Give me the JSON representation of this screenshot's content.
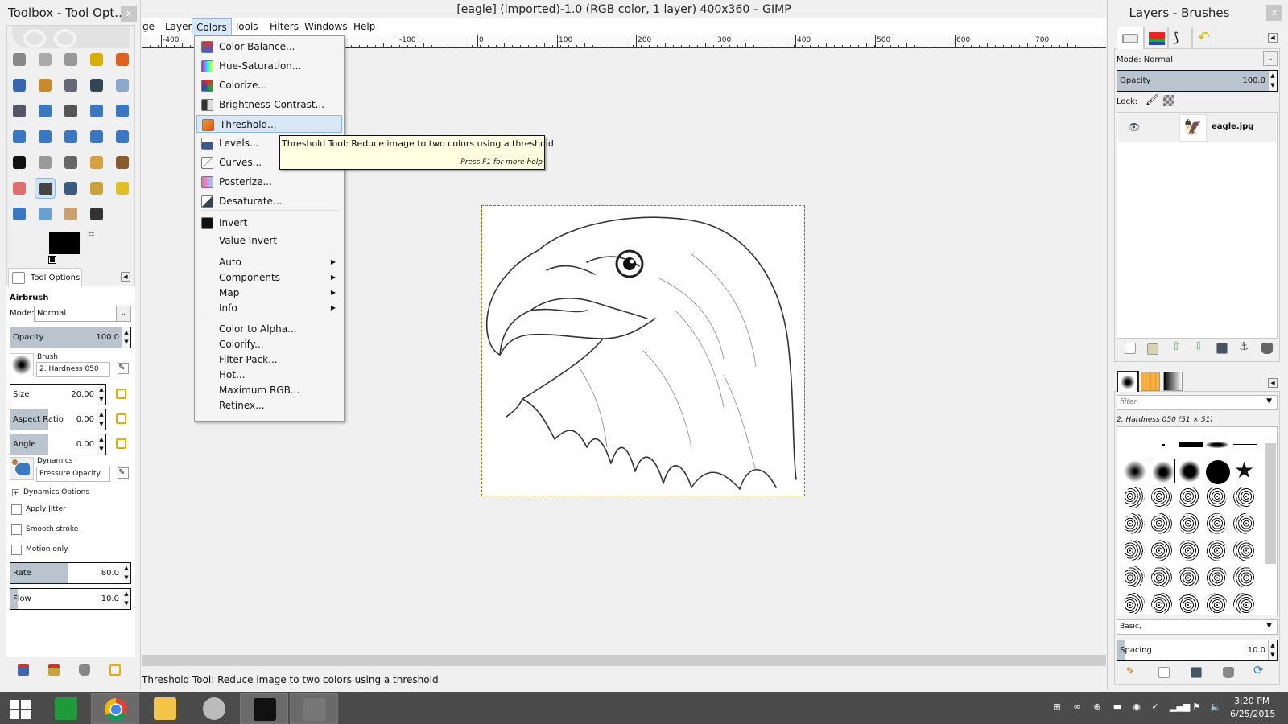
{
  "toolbox": {
    "title": "Toolbox - Tool Opt...",
    "close": "x",
    "tools": [
      "rect-select",
      "ellipse-select",
      "free-select",
      "fuzzy-select",
      "select-by-color",
      "scissors-select",
      "foreground-select",
      "paths",
      "color-picker",
      "zoom",
      "measure",
      "move",
      "align",
      "crop",
      "rotate",
      "scale",
      "shear",
      "perspective",
      "flip",
      "cage-transform",
      "text",
      "bucket-fill",
      "blend",
      "pencil",
      "paintbrush",
      "eraser",
      "airbrush",
      "ink",
      "clone",
      "heal",
      "perspective-clone",
      "blur-sharpen",
      "smudge",
      "dodge-burn"
    ],
    "selected_tool": "airbrush",
    "fg_color": "#000000",
    "bg_color": "#ffffff"
  },
  "tool_options": {
    "tab": "Tool Options",
    "tool_name": "Airbrush",
    "mode_label": "Mode:",
    "mode_value": "Normal",
    "opacity": {
      "label": "Opacity",
      "value": "100.0",
      "fraction": 1.0
    },
    "brush_label": "Brush",
    "brush_value": "2. Hardness 050",
    "size": {
      "label": "Size",
      "value": "20.00"
    },
    "aspect": {
      "label": "Aspect Ratio",
      "value": "0.00"
    },
    "angle": {
      "label": "Angle",
      "value": "0.00"
    },
    "dynamics_label": "Dynamics",
    "dynamics_value": "Pressure Opacity",
    "dynamics_options": "Dynamics Options",
    "apply_jitter": "Apply Jitter",
    "smooth_stroke": "Smooth stroke",
    "motion_only": "Motion only",
    "rate": {
      "label": "Rate",
      "value": "80.0",
      "fraction": 0.8
    },
    "flow": {
      "label": "Flow",
      "value": "10.0",
      "fraction": 0.1
    }
  },
  "main": {
    "title": "[eagle] (imported)-1.0 (RGB color, 1 layer) 400x360 – GIMP",
    "menubar": [
      "ge",
      "Layer",
      "Colors",
      "Tools",
      "Filters",
      "Windows",
      "Help"
    ],
    "active_menu": "Colors",
    "ruler_labels": [
      "-400",
      "-100",
      "0",
      "100",
      "200",
      "300",
      "400",
      "500",
      "600",
      "700"
    ],
    "status": "Threshold Tool: Reduce image to two colors using a threshold"
  },
  "colors_menu": {
    "items": [
      {
        "label": "Color Balance...",
        "icon": "color-balance-icon"
      },
      {
        "label": "Hue-Saturation...",
        "icon": "hue-saturation-icon"
      },
      {
        "label": "Colorize...",
        "icon": "colorize-icon"
      },
      {
        "label": "Brightness-Contrast...",
        "icon": "brightness-contrast-icon"
      },
      {
        "label": "Threshold...",
        "icon": "threshold-icon"
      },
      {
        "label": "Levels...",
        "icon": "levels-icon"
      },
      {
        "label": "Curves...",
        "icon": "curves-icon"
      },
      {
        "label": "Posterize...",
        "icon": "posterize-icon"
      },
      {
        "label": "Desaturate...",
        "icon": "desaturate-icon"
      },
      {
        "label": "Invert",
        "icon": "invert-icon"
      },
      {
        "label": "Value Invert"
      },
      {
        "label": "Auto",
        "submenu": true
      },
      {
        "label": "Components",
        "submenu": true
      },
      {
        "label": "Map",
        "submenu": true
      },
      {
        "label": "Info",
        "submenu": true
      },
      {
        "label": "Color to Alpha..."
      },
      {
        "label": "Colorify..."
      },
      {
        "label": "Filter Pack..."
      },
      {
        "label": "Hot..."
      },
      {
        "label": "Maximum RGB..."
      },
      {
        "label": "Retinex..."
      }
    ],
    "highlighted": "Threshold..."
  },
  "tooltip": {
    "text": "Threshold Tool: Reduce image to two colors using a threshold",
    "help": "Press F1 for more help"
  },
  "dock": {
    "title": "Layers - Brushes",
    "close": "x",
    "mode_label": "Mode: Normal",
    "opacity": {
      "label": "Opacity",
      "value": "100.0",
      "fraction": 1.0
    },
    "lock_label": "Lock:",
    "layers": [
      {
        "name": "eagle.jpg",
        "visible": true
      }
    ],
    "brush_filter_placeholder": "filter",
    "brush_selected": "2. Hardness 050 (51 × 51)",
    "brush_tag": "Basic,",
    "spacing": {
      "label": "Spacing",
      "value": "10.0",
      "fraction": 0.05
    }
  },
  "taskbar": {
    "time": "3:20 PM",
    "date": "6/25/2015",
    "apps": [
      "start",
      "store",
      "chrome",
      "file-explorer",
      "speaker-app",
      "gopro",
      "gimp"
    ]
  }
}
